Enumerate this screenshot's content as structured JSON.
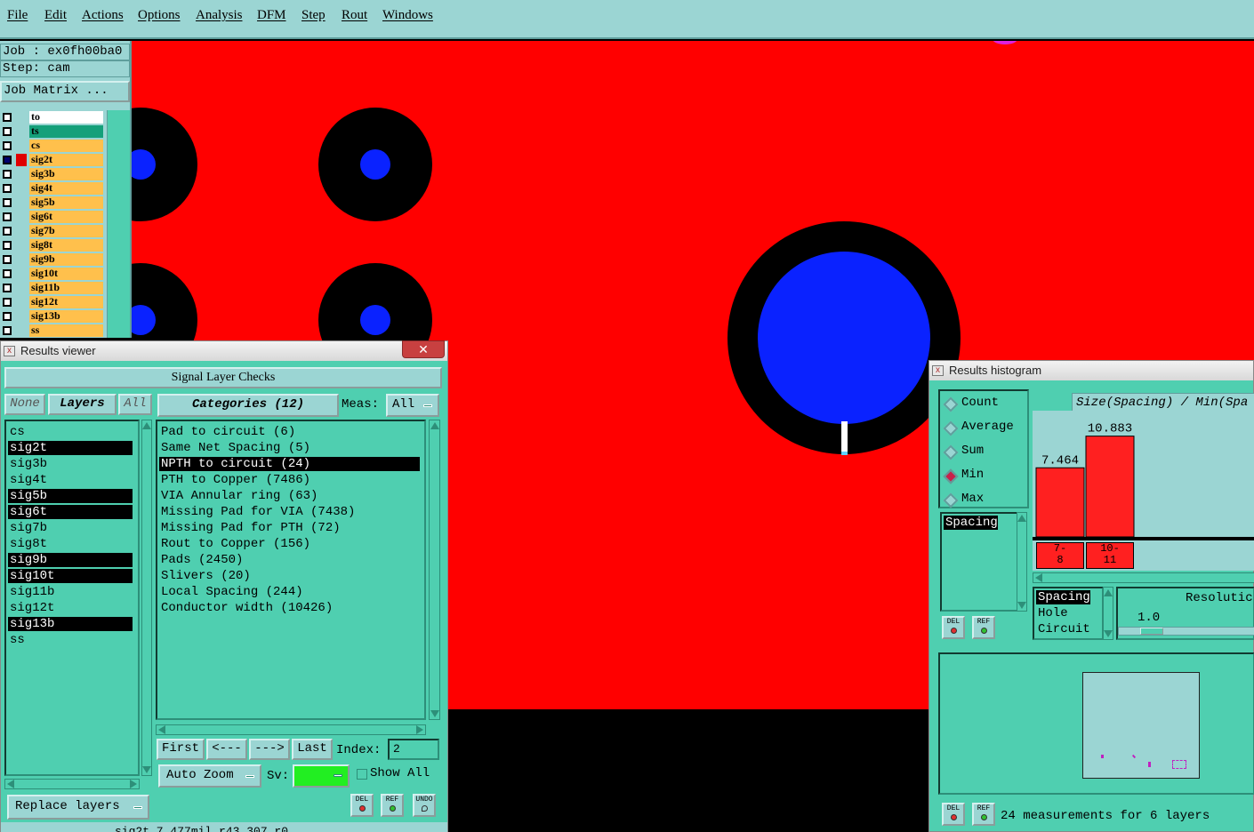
{
  "menu": [
    "File",
    "Edit",
    "Actions",
    "Options",
    "Analysis",
    "DFM",
    "Step",
    "Rout",
    "Windows"
  ],
  "left_panel": {
    "job_line": "Job : ex0fh00ba0",
    "step_line": "Step: cam",
    "job_matrix_button": "Job Matrix ...",
    "layers": [
      {
        "name": "to",
        "color": "#ffffff",
        "selected": false,
        "swatch": ""
      },
      {
        "name": "ts",
        "color": "#14a07a",
        "selected": false,
        "swatch": ""
      },
      {
        "name": "cs",
        "color": "#ffc04c",
        "selected": false,
        "swatch": ""
      },
      {
        "name": "sig2t",
        "color": "#ffc04c",
        "selected": true,
        "swatch": "#e00000"
      },
      {
        "name": "sig3b",
        "color": "#ffc04c",
        "selected": false,
        "swatch": ""
      },
      {
        "name": "sig4t",
        "color": "#ffc04c",
        "selected": false,
        "swatch": ""
      },
      {
        "name": "sig5b",
        "color": "#ffc04c",
        "selected": false,
        "swatch": ""
      },
      {
        "name": "sig6t",
        "color": "#ffc04c",
        "selected": false,
        "swatch": ""
      },
      {
        "name": "sig7b",
        "color": "#ffc04c",
        "selected": false,
        "swatch": ""
      },
      {
        "name": "sig8t",
        "color": "#ffc04c",
        "selected": false,
        "swatch": ""
      },
      {
        "name": "sig9b",
        "color": "#ffc04c",
        "selected": false,
        "swatch": ""
      },
      {
        "name": "sig10t",
        "color": "#ffc04c",
        "selected": false,
        "swatch": ""
      },
      {
        "name": "sig11b",
        "color": "#ffc04c",
        "selected": false,
        "swatch": ""
      },
      {
        "name": "sig12t",
        "color": "#ffc04c",
        "selected": false,
        "swatch": ""
      },
      {
        "name": "sig13b",
        "color": "#ffc04c",
        "selected": false,
        "swatch": ""
      },
      {
        "name": "ss",
        "color": "#ffc04c",
        "selected": false,
        "swatch": ""
      }
    ]
  },
  "results_viewer": {
    "title": "Results viewer",
    "close": "✕",
    "header": "Signal Layer Checks",
    "none_button": "None",
    "layers_label": "Layers",
    "all_button": "All",
    "categories_label": "Categories (12)",
    "meas_label": "Meas:",
    "meas_value": "All",
    "layer_items": [
      {
        "name": "cs",
        "sel": false
      },
      {
        "name": "sig2t",
        "sel": true
      },
      {
        "name": "sig3b",
        "sel": false
      },
      {
        "name": "sig4t",
        "sel": false
      },
      {
        "name": "sig5b",
        "sel": true
      },
      {
        "name": "sig6t",
        "sel": true
      },
      {
        "name": "sig7b",
        "sel": false
      },
      {
        "name": "sig8t",
        "sel": false
      },
      {
        "name": "sig9b",
        "sel": true
      },
      {
        "name": "sig10t",
        "sel": true
      },
      {
        "name": "sig11b",
        "sel": false
      },
      {
        "name": "sig12t",
        "sel": false
      },
      {
        "name": "sig13b",
        "sel": true
      },
      {
        "name": "ss",
        "sel": false
      }
    ],
    "categories": [
      {
        "name": "Pad to circuit (6)",
        "sel": false
      },
      {
        "name": "Same Net Spacing (5)",
        "sel": false
      },
      {
        "name": "NPTH to circuit (24)",
        "sel": true
      },
      {
        "name": "PTH to Copper (7486)",
        "sel": false
      },
      {
        "name": "VIA Annular ring (63)",
        "sel": false
      },
      {
        "name": "Missing Pad for VIA (7438)",
        "sel": false
      },
      {
        "name": "Missing Pad for PTH (72)",
        "sel": false
      },
      {
        "name": "Rout to Copper (156)",
        "sel": false
      },
      {
        "name": "Pads (2450)",
        "sel": false
      },
      {
        "name": "Slivers (20)",
        "sel": false
      },
      {
        "name": "Local Spacing (244)",
        "sel": false
      },
      {
        "name": "Conductor width (10426)",
        "sel": false
      }
    ],
    "first": "First",
    "prev": "<---",
    "next": "--->",
    "last": "Last",
    "index_label": "Index:",
    "index_value": "2",
    "auto_zoom": "Auto Zoom",
    "sv_label": "Sv:",
    "show_all": "Show All",
    "replace_layers": "Replace layers",
    "del": "DEL",
    "ref": "REF",
    "undo": "UNDO",
    "status": "sig2t 7.477mil  r43.307  r0"
  },
  "histogram": {
    "title": "Results histogram",
    "modes": [
      {
        "name": "Count",
        "on": false
      },
      {
        "name": "Average",
        "on": false
      },
      {
        "name": "Sum",
        "on": false
      },
      {
        "name": "Min",
        "on": true
      },
      {
        "name": "Max",
        "on": false
      }
    ],
    "chart_title": "Size(Spacing) / Min(Spa",
    "list1": [
      "Spacing"
    ],
    "list2": [
      "Spacing",
      "Hole",
      "Circuit"
    ],
    "resolution_label": "Resolutic",
    "resolution_value": "1.0",
    "del": "DEL",
    "ref": "REF",
    "summary": "24 measurements for 6 layers"
  },
  "chart_data": {
    "type": "bar",
    "title": "Size(Spacing) / Min(Spa",
    "categories": [
      "7-\n8",
      "10-\n11"
    ],
    "cat_lines": [
      [
        "7-",
        "8"
      ],
      [
        "10-",
        "11"
      ]
    ],
    "values": [
      7.464,
      10.883
    ],
    "value_labels": [
      "7.464",
      "10.883"
    ],
    "ylim": [
      0,
      12
    ],
    "bar_color": "#ff2020"
  },
  "colors": {
    "panel": "#9bd5d3",
    "window": "#4fcfb0",
    "copper": "#ff0000",
    "hole": "#0022ff",
    "swatch_green": "#22ee22"
  }
}
